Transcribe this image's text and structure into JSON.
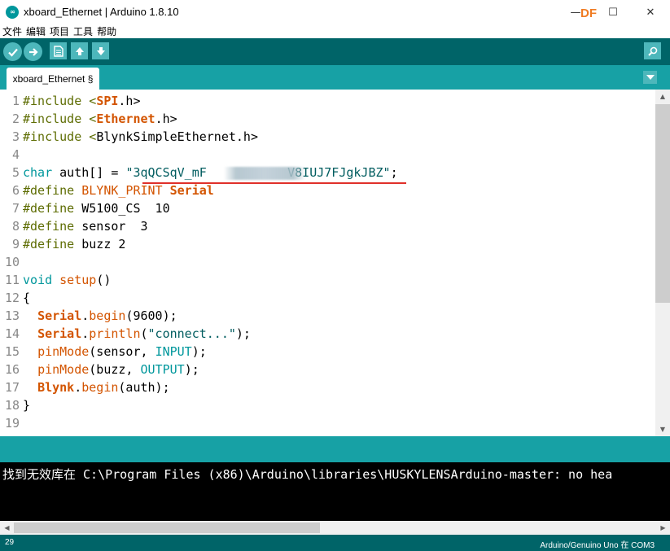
{
  "window": {
    "title": "xboard_Ethernet | Arduino 1.8.10",
    "app_icon_text": "∞",
    "min": "—",
    "max": "☐",
    "close": "✕",
    "watermark": "DF"
  },
  "menu": [
    "文件",
    "编辑",
    "项目",
    "工具",
    "帮助"
  ],
  "toolbar": {
    "verify_icon": "checkmark-icon",
    "upload_icon": "arrow-right-icon",
    "new_icon": "new-file-icon",
    "open_icon": "arrow-up-icon",
    "save_icon": "arrow-down-icon",
    "serial_icon": "magnifier-icon"
  },
  "tabs": {
    "active": "xboard_Ethernet §",
    "menu_icon": "chevron-down-icon"
  },
  "code_lines": [
    {
      "n": "1",
      "parts": [
        [
          "inc",
          "#include <"
        ],
        [
          "lib",
          "SPI"
        ],
        [
          "plain",
          ".h>"
        ]
      ]
    },
    {
      "n": "2",
      "parts": [
        [
          "inc",
          "#include <"
        ],
        [
          "lib",
          "Ethernet"
        ],
        [
          "plain",
          ".h>"
        ]
      ]
    },
    {
      "n": "3",
      "parts": [
        [
          "inc",
          "#include <"
        ],
        [
          "plain",
          "BlynkSimpleEthernet.h>"
        ]
      ]
    },
    {
      "n": "4",
      "parts": []
    },
    {
      "n": "5",
      "parts": [
        [
          "teal",
          "char"
        ],
        [
          "plain",
          " auth[] = "
        ],
        [
          "str",
          "\"3qQCSqV_mF"
        ],
        [
          "str",
          "           "
        ],
        [
          "str",
          "V8IUJ7FJgkJBZ\""
        ],
        [
          "plain",
          ";"
        ]
      ]
    },
    {
      "n": "6",
      "parts": [
        [
          "inc",
          "#define "
        ],
        [
          "orange",
          "BLYNK_PRINT "
        ],
        [
          "bold",
          "Serial"
        ]
      ]
    },
    {
      "n": "7",
      "parts": [
        [
          "inc",
          "#define "
        ],
        [
          "plain",
          "W5100_CS  10"
        ]
      ]
    },
    {
      "n": "8",
      "parts": [
        [
          "inc",
          "#define "
        ],
        [
          "plain",
          "sensor  3"
        ]
      ]
    },
    {
      "n": "9",
      "parts": [
        [
          "inc",
          "#define "
        ],
        [
          "plain",
          "buzz 2"
        ]
      ]
    },
    {
      "n": "10",
      "parts": []
    },
    {
      "n": "11",
      "parts": [
        [
          "teal",
          "void "
        ],
        [
          "orange",
          "setup"
        ],
        [
          "plain",
          "()"
        ]
      ]
    },
    {
      "n": "12",
      "parts": [
        [
          "plain",
          "{"
        ]
      ]
    },
    {
      "n": "13",
      "parts": [
        [
          "plain",
          "  "
        ],
        [
          "bold",
          "Serial"
        ],
        [
          "plain",
          "."
        ],
        [
          "orange",
          "begin"
        ],
        [
          "plain",
          "(9600);"
        ]
      ]
    },
    {
      "n": "14",
      "parts": [
        [
          "plain",
          "  "
        ],
        [
          "bold",
          "Serial"
        ],
        [
          "plain",
          "."
        ],
        [
          "orange",
          "println"
        ],
        [
          "plain",
          "("
        ],
        [
          "str",
          "\"connect...\""
        ],
        [
          "plain",
          ");"
        ]
      ]
    },
    {
      "n": "15",
      "parts": [
        [
          "plain",
          "  "
        ],
        [
          "orange",
          "pinMode"
        ],
        [
          "plain",
          "(sensor, "
        ],
        [
          "teal",
          "INPUT"
        ],
        [
          "plain",
          ");"
        ]
      ]
    },
    {
      "n": "16",
      "parts": [
        [
          "plain",
          "  "
        ],
        [
          "orange",
          "pinMode"
        ],
        [
          "plain",
          "(buzz, "
        ],
        [
          "teal",
          "OUTPUT"
        ],
        [
          "plain",
          ");"
        ]
      ]
    },
    {
      "n": "17",
      "parts": [
        [
          "plain",
          "  "
        ],
        [
          "bold",
          "Blynk"
        ],
        [
          "plain",
          "."
        ],
        [
          "orange",
          "begin"
        ],
        [
          "plain",
          "(auth);"
        ]
      ]
    },
    {
      "n": "18",
      "parts": [
        [
          "plain",
          "}"
        ]
      ]
    },
    {
      "n": "19",
      "parts": []
    }
  ],
  "console": {
    "line": "找到无效库在 C:\\Program Files (x86)\\Arduino\\libraries\\HUSKYLENSArduino-master: no hea"
  },
  "status": {
    "line_number": "29",
    "board": "Arduino/Genuino Uno 在 COM3"
  },
  "colors": {
    "toolbar": "#006468",
    "tabbar": "#17a1a5",
    "button": "#4db7bb",
    "console": "#000000",
    "highlight_underline": "#e0302a"
  }
}
